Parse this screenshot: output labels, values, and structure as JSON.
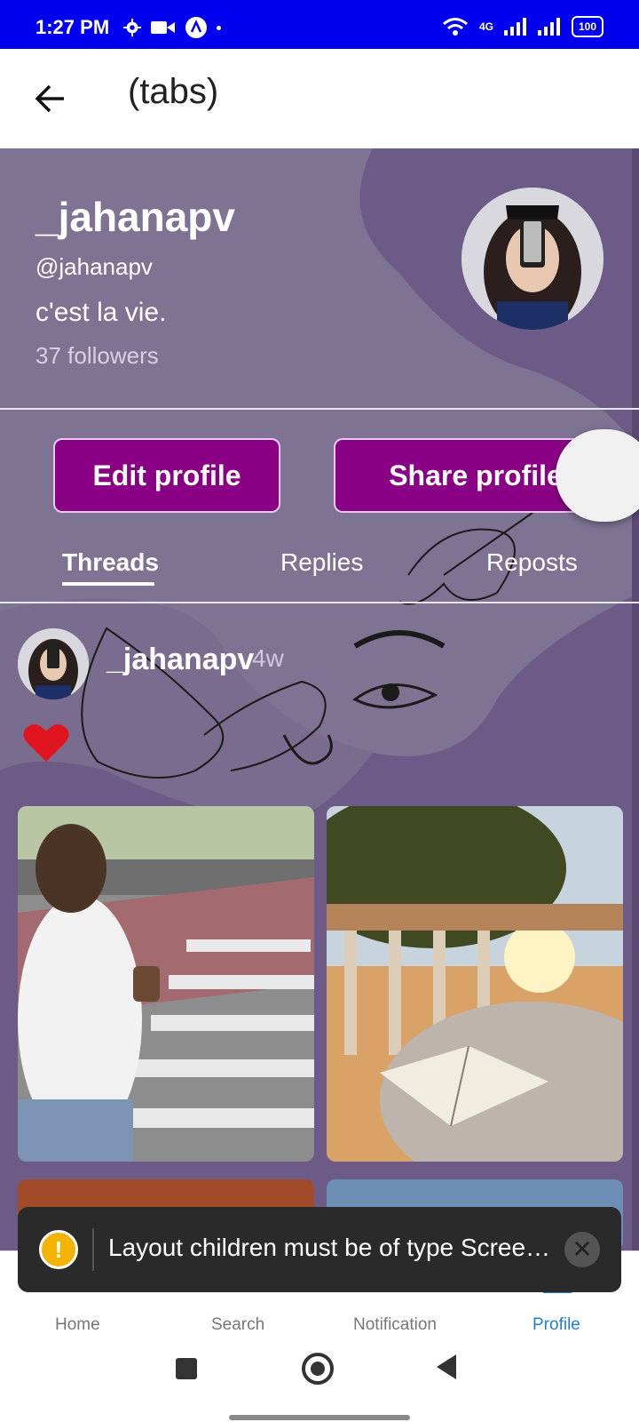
{
  "status_bar": {
    "time": "1:27 PM",
    "network": "4G",
    "battery": "100"
  },
  "header": {
    "title": "(tabs)"
  },
  "profile": {
    "name": "_jahanapv",
    "handle": "@jahanapv",
    "bio": "c'est la vie.",
    "followers": "37 followers"
  },
  "buttons": {
    "edit": "Edit profile",
    "share": "Share profile"
  },
  "tabs": [
    {
      "label": "Threads",
      "active": true
    },
    {
      "label": "Replies",
      "active": false
    },
    {
      "label": "Reposts",
      "active": false
    }
  ],
  "post": {
    "user": "_jahanapv",
    "time": "4w",
    "emoji": "❤️"
  },
  "bottom_nav": [
    {
      "label": "Home",
      "icon": "home-icon"
    },
    {
      "label": "Search",
      "icon": "search-icon"
    },
    {
      "label": "Notification",
      "icon": "heart-icon"
    },
    {
      "label": "Profile",
      "icon": "person-icon",
      "active": true
    }
  ],
  "toast": {
    "message": "Layout children must be of type Screen…"
  },
  "colors": {
    "status_bar": "#0000ee",
    "profile_bg": "#6c5a87",
    "button": "#8a0085",
    "active_nav": "#1e7fd8"
  }
}
